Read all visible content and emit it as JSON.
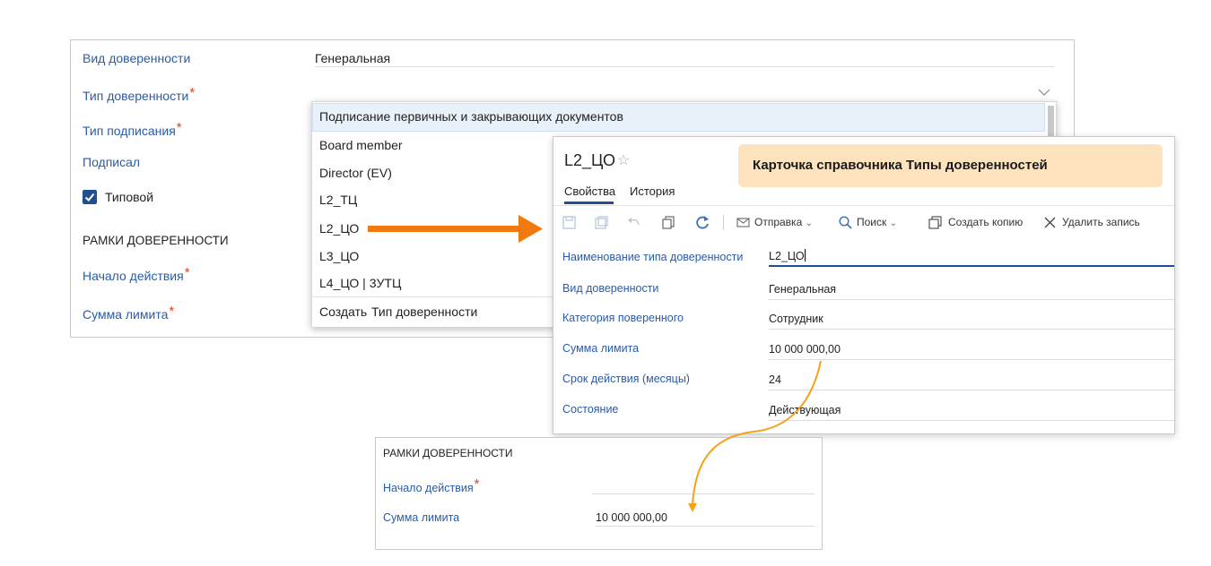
{
  "form": {
    "kind_label": "Вид доверенности",
    "kind_value": "Генеральная",
    "type_label": "Тип доверенности",
    "sign_label": "Тип подписания",
    "signed_label": "Подписал",
    "typical_label": "Типовой",
    "typical_checked": true,
    "section_title": "РАМКИ ДОВЕРЕННОСТИ",
    "start_label": "Начало действия",
    "limit_label": "Сумма лимита",
    "required_mark": "*"
  },
  "dropdown": {
    "items": [
      "Подписание первичных и закрывающих документов",
      "Board member",
      "Director (EV)",
      "L2_ТЦ",
      "L2_ЦО",
      "L3_ЦО",
      "L4_ЦО | 3УТЦ"
    ],
    "create_prefix": "Создать",
    "create_link": "Тип доверенности"
  },
  "callout": {
    "text": "Карточка справочника Типы доверенностей"
  },
  "card": {
    "title": "L2_ЦО",
    "tabs": [
      "Свойства",
      "История"
    ],
    "active_tab": "Свойства",
    "toolbar": {
      "send": "Отправка",
      "search": "Поиск",
      "copy": "Создать копию",
      "delete": "Удалить запись"
    },
    "fields": [
      {
        "label": "Наименование типа доверенности",
        "value": "L2_ЦО"
      },
      {
        "label": "Вид доверенности",
        "value": "Генеральная"
      },
      {
        "label": "Категория поверенного",
        "value": "Сотрудник"
      },
      {
        "label": "Сумма лимита",
        "value": "10 000 000,00"
      },
      {
        "label": "Срок действия (месяцы)",
        "value": "24"
      },
      {
        "label": "Состояние",
        "value": "Действующая"
      }
    ]
  },
  "frame": {
    "section_title": "РАМКИ ДОВЕРЕННОСТИ",
    "start_label": "Начало действия",
    "limit_label": "Сумма лимита",
    "limit_value": "10 000 000,00"
  },
  "colors": {
    "label_blue": "#2a5ba8",
    "required_red": "#e0421b",
    "arrow_orange": "#f07a10",
    "callout_bg": "#fde3bd"
  }
}
